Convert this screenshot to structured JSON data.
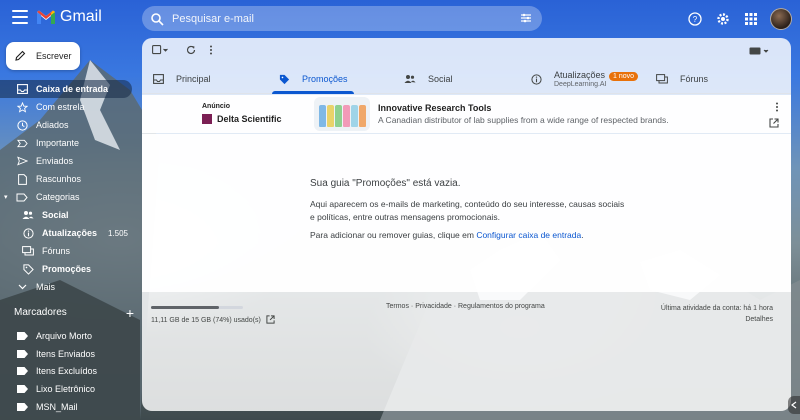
{
  "app": {
    "name": "Gmail"
  },
  "search": {
    "placeholder": "Pesquisar e-mail"
  },
  "compose": {
    "label": "Escrever"
  },
  "sidebar": {
    "items": [
      {
        "label": "Caixa de entrada",
        "icon": "inbox-icon",
        "active": true
      },
      {
        "label": "Com estrela",
        "icon": "star-icon"
      },
      {
        "label": "Adiados",
        "icon": "clock-icon"
      },
      {
        "label": "Importante",
        "icon": "important-icon"
      },
      {
        "label": "Enviados",
        "icon": "send-icon"
      },
      {
        "label": "Rascunhos",
        "icon": "draft-icon"
      },
      {
        "label": "Categorias",
        "icon": "label-icon"
      }
    ],
    "categories": [
      {
        "label": "Social",
        "icon": "people-icon"
      },
      {
        "label": "Atualizações",
        "icon": "info-icon",
        "count": "1.505"
      },
      {
        "label": "Fóruns",
        "icon": "forum-icon"
      },
      {
        "label": "Promoções",
        "icon": "tag-icon"
      }
    ],
    "more_label": "Mais",
    "labels_heading": "Marcadores",
    "labels": [
      {
        "label": "Arquivo Morto"
      },
      {
        "label": "Itens Enviados"
      },
      {
        "label": "Itens Excluídos"
      },
      {
        "label": "Lixo Eletrônico"
      },
      {
        "label": "MSN_Mail"
      }
    ]
  },
  "tabs": [
    {
      "label": "Principal",
      "icon": "inbox-icon"
    },
    {
      "label": "Promoções",
      "icon": "tag-icon",
      "active": true
    },
    {
      "label": "Social",
      "icon": "people-icon"
    },
    {
      "label": "Atualizações",
      "icon": "info-icon",
      "badge": "1 novo",
      "sub": "DeepLearning.AI"
    },
    {
      "label": "Fóruns",
      "icon": "forum-icon"
    }
  ],
  "ad": {
    "tag": "Anúncio",
    "sender": "Delta Scientific",
    "title": "Innovative Research Tools",
    "description": "A Canadian distributor of lab supplies from a wide range of respected brands."
  },
  "empty": {
    "title": "Sua guia \"Promoções\" está vazia.",
    "body": "Aqui aparecem os e-mails de marketing, conteúdo do seu interesse, causas sociais e políticas, entre outras mensagens promocionais.",
    "hint_prefix": "Para adicionar ou remover guias, clique em ",
    "hint_link": "Configurar caixa de entrada",
    "hint_suffix": "."
  },
  "footer": {
    "storage": "11,11 GB de 15 GB (74%) usado(s)",
    "storage_fraction": 0.74,
    "terms": "Termos",
    "privacy": "Privacidade",
    "policies": "Regulamentos do programa",
    "sep": " · ",
    "activity": "Última atividade da conta: há 1 hora",
    "details": "Detalhes"
  },
  "colors": {
    "accent": "#0b57d0",
    "badge": "#e8710a"
  }
}
